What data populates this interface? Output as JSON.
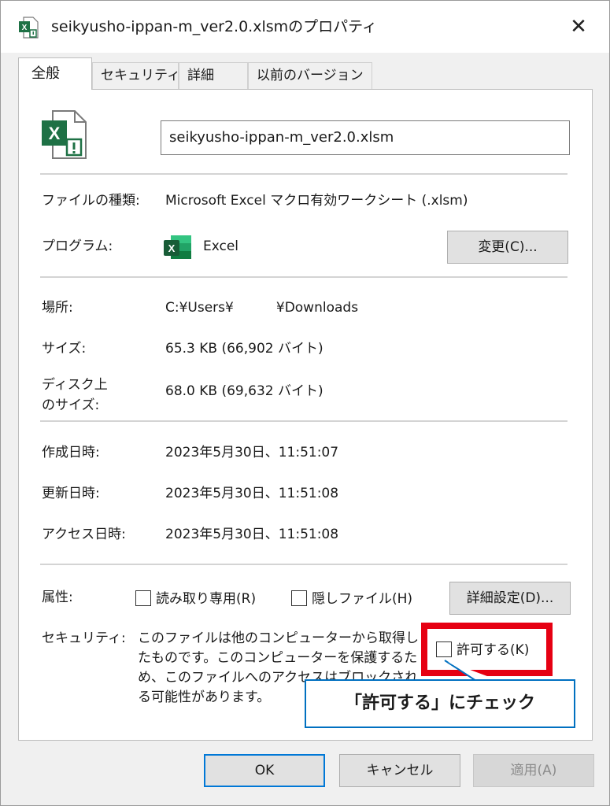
{
  "window": {
    "title": "seikyusho-ippan-m_ver2.0.xlsmのプロパティ",
    "close_glyph": "✕"
  },
  "tabs": [
    {
      "label": "全般",
      "active": true
    },
    {
      "label": "セキュリティ",
      "active": false
    },
    {
      "label": "詳細",
      "active": false
    },
    {
      "label": "以前のバージョン",
      "active": false
    }
  ],
  "general": {
    "filename": "seikyusho-ippan-m_ver2.0.xlsm",
    "file_type_label": "ファイルの種類:",
    "file_type_value": "Microsoft Excel マクロ有効ワークシート (.xlsm)",
    "program_label": "プログラム:",
    "program_value": "Excel",
    "change_button": "変更(C)...",
    "location_label": "場所:",
    "location_value": "C:¥Users¥          ¥Downloads",
    "size_label": "サイズ:",
    "size_value": "65.3 KB (66,902 バイト)",
    "disk_size_label_1": "ディスク上",
    "disk_size_label_2": "のサイズ:",
    "disk_size_value": "68.0 KB (69,632 バイト)",
    "created_label": "作成日時:",
    "created_value": "2023年5月30日、11:51:07",
    "modified_label": "更新日時:",
    "modified_value": "2023年5月30日、11:51:08",
    "accessed_label": "アクセス日時:",
    "accessed_value": "2023年5月30日、11:51:08",
    "attributes_label": "属性:",
    "readonly_label": "読み取り専用(R)",
    "hidden_label": "隠しファイル(H)",
    "advanced_button": "詳細設定(D)...",
    "security_label": "セキュリティ:",
    "security_text": "このファイルは他のコンピューターから取得したものです。このコンピューターを保護するため、このファイルへのアクセスはブロックされる可能性があります。",
    "unblock_label": "許可する(K)"
  },
  "callout": {
    "text": "「許可する」にチェック"
  },
  "footer": {
    "ok": "OK",
    "cancel": "キャンセル",
    "apply": "適用(A)"
  },
  "colors": {
    "excel_green": "#1e7145",
    "highlight_red": "#e60012",
    "callout_blue": "#0070c0",
    "focus_blue": "#0078d7"
  },
  "icons": {
    "title": "excel-file-icon",
    "file": "excel-macro-file-icon",
    "program": "excel-app-icon",
    "close": "close-icon"
  }
}
